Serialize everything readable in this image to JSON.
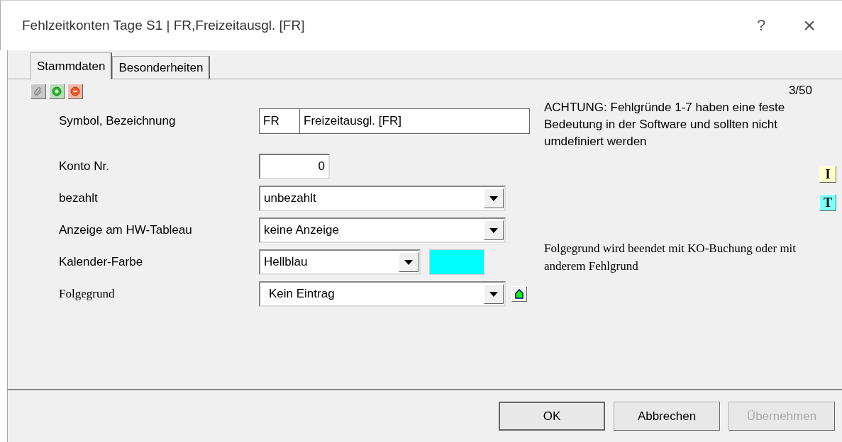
{
  "window": {
    "title": "Fehlzeitkonten Tage S1 | FR,Freizeitausgl. [FR]",
    "help": "?",
    "close": "×"
  },
  "tabs": [
    {
      "label": "Stammdaten",
      "selected": true
    },
    {
      "label": "Besonderheiten",
      "selected": false
    }
  ],
  "counter": "3/50",
  "warning": "ACHTUNG: Fehlgründe 1-7 haben eine feste Bedeutung in der Software und sollten nicht umdefiniert werden",
  "fields": [
    {
      "kind": "pair",
      "label": "Symbol, Bezeichnung",
      "code": "FR",
      "value": "Freizeitausgl. [FR]"
    },
    {
      "kind": "number",
      "label": "Konto Nr.",
      "value": "0"
    },
    {
      "kind": "select",
      "label": "bezahlt",
      "value": "unbezahlt"
    },
    {
      "kind": "select",
      "label": "Anzeige am HW-Tableau",
      "value": "keine Anzeige"
    },
    {
      "kind": "color",
      "label": "Kalender-Farbe",
      "value": "Hellblau",
      "color": "#00ffff"
    },
    {
      "kind": "select-action",
      "label": "Folgegrund",
      "value": "Kein Eintrag"
    }
  ],
  "side_buttons": [
    {
      "label": "I",
      "color": "#ffffc8"
    },
    {
      "label": "T",
      "color": "#80ffff"
    }
  ],
  "note": "Folgegrund wird beendet mit KO-Buchung oder mit anderem Fehlgrund",
  "buttons": [
    {
      "label": "OK",
      "default": true,
      "disabled": false
    },
    {
      "label": "Abbrechen",
      "default": false,
      "disabled": false
    },
    {
      "label": "Übernehmen",
      "default": false,
      "disabled": true
    }
  ]
}
